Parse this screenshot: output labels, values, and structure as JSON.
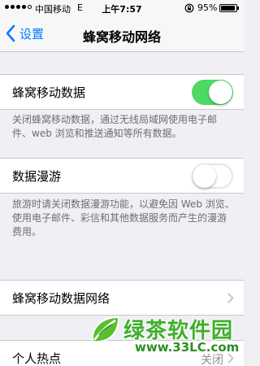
{
  "status_bar": {
    "carrier": "中国移动",
    "network_type": "E",
    "time": "上午7:57",
    "battery_percent": "95%",
    "battery_level": 0.95,
    "signal_bars": 5,
    "signal_filled": 4
  },
  "nav": {
    "back_label": "设置",
    "title": "蜂窝移动网络"
  },
  "cellular_data": {
    "label": "蜂窝移动数据",
    "enabled": true,
    "toggle_on_color": "#4cd964",
    "description": "关闭蜂窝移动数据，通过无线局域网使用电子邮件、web 浏览和推送通知等所有数据。"
  },
  "data_roaming": {
    "label": "数据漫游",
    "enabled": false,
    "description": "旅游时请关闭数据漫游功能，以避免因 Web 浏览、使用电子邮件、彩信和其他数据服务而产生的漫游费用。"
  },
  "cellular_data_network": {
    "label": "蜂窝移动数据网络"
  },
  "personal_hotspot": {
    "label": "个人热点",
    "value": "关闭"
  },
  "watermark": {
    "title": "绿茶软件园",
    "url": "www.33LC.com"
  },
  "colors": {
    "accent": "#007aff",
    "background": "#efeff4",
    "watermark_green": "#3fae2a"
  },
  "icons": {
    "back": "chevron-left-icon",
    "lock": "rotation-lock-icon",
    "disclosure": "chevron-right-icon"
  }
}
